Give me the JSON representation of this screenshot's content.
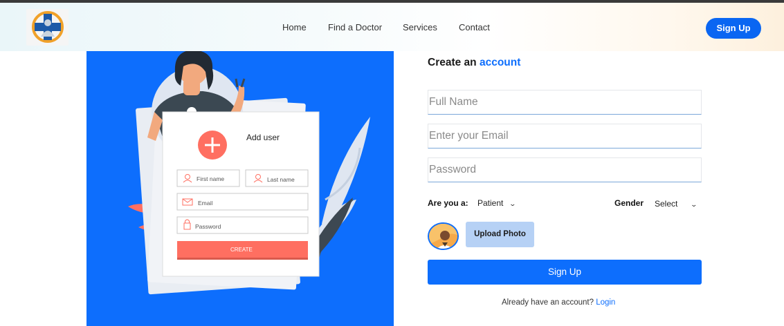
{
  "header": {
    "logo_icon": "medical-cross-logo-icon",
    "nav": [
      "Home",
      "Find a Doctor",
      "Services",
      "Contact"
    ],
    "signup_label": "Sign Up"
  },
  "illustration": {
    "card_title": "Add user",
    "first_name": "First name",
    "last_name": "Last name",
    "email": "Email",
    "password": "Password",
    "create": "CREATE"
  },
  "form": {
    "title_prefix": "Create an",
    "title_accent": "account",
    "full_name_placeholder": "Full Name",
    "email_placeholder": "Enter your Email",
    "password_placeholder": "Password",
    "role_label": "Are you a:",
    "role_value": "Patient",
    "gender_label": "Gender",
    "gender_value": "Select",
    "upload_label": "Upload Photo",
    "submit_label": "Sign Up",
    "already_text": "Already have an account?",
    "login_label": "Login"
  },
  "colors": {
    "accent": "#0d6efd",
    "create_button": "#ff6f61",
    "upload_button": "#b6d1f5"
  }
}
